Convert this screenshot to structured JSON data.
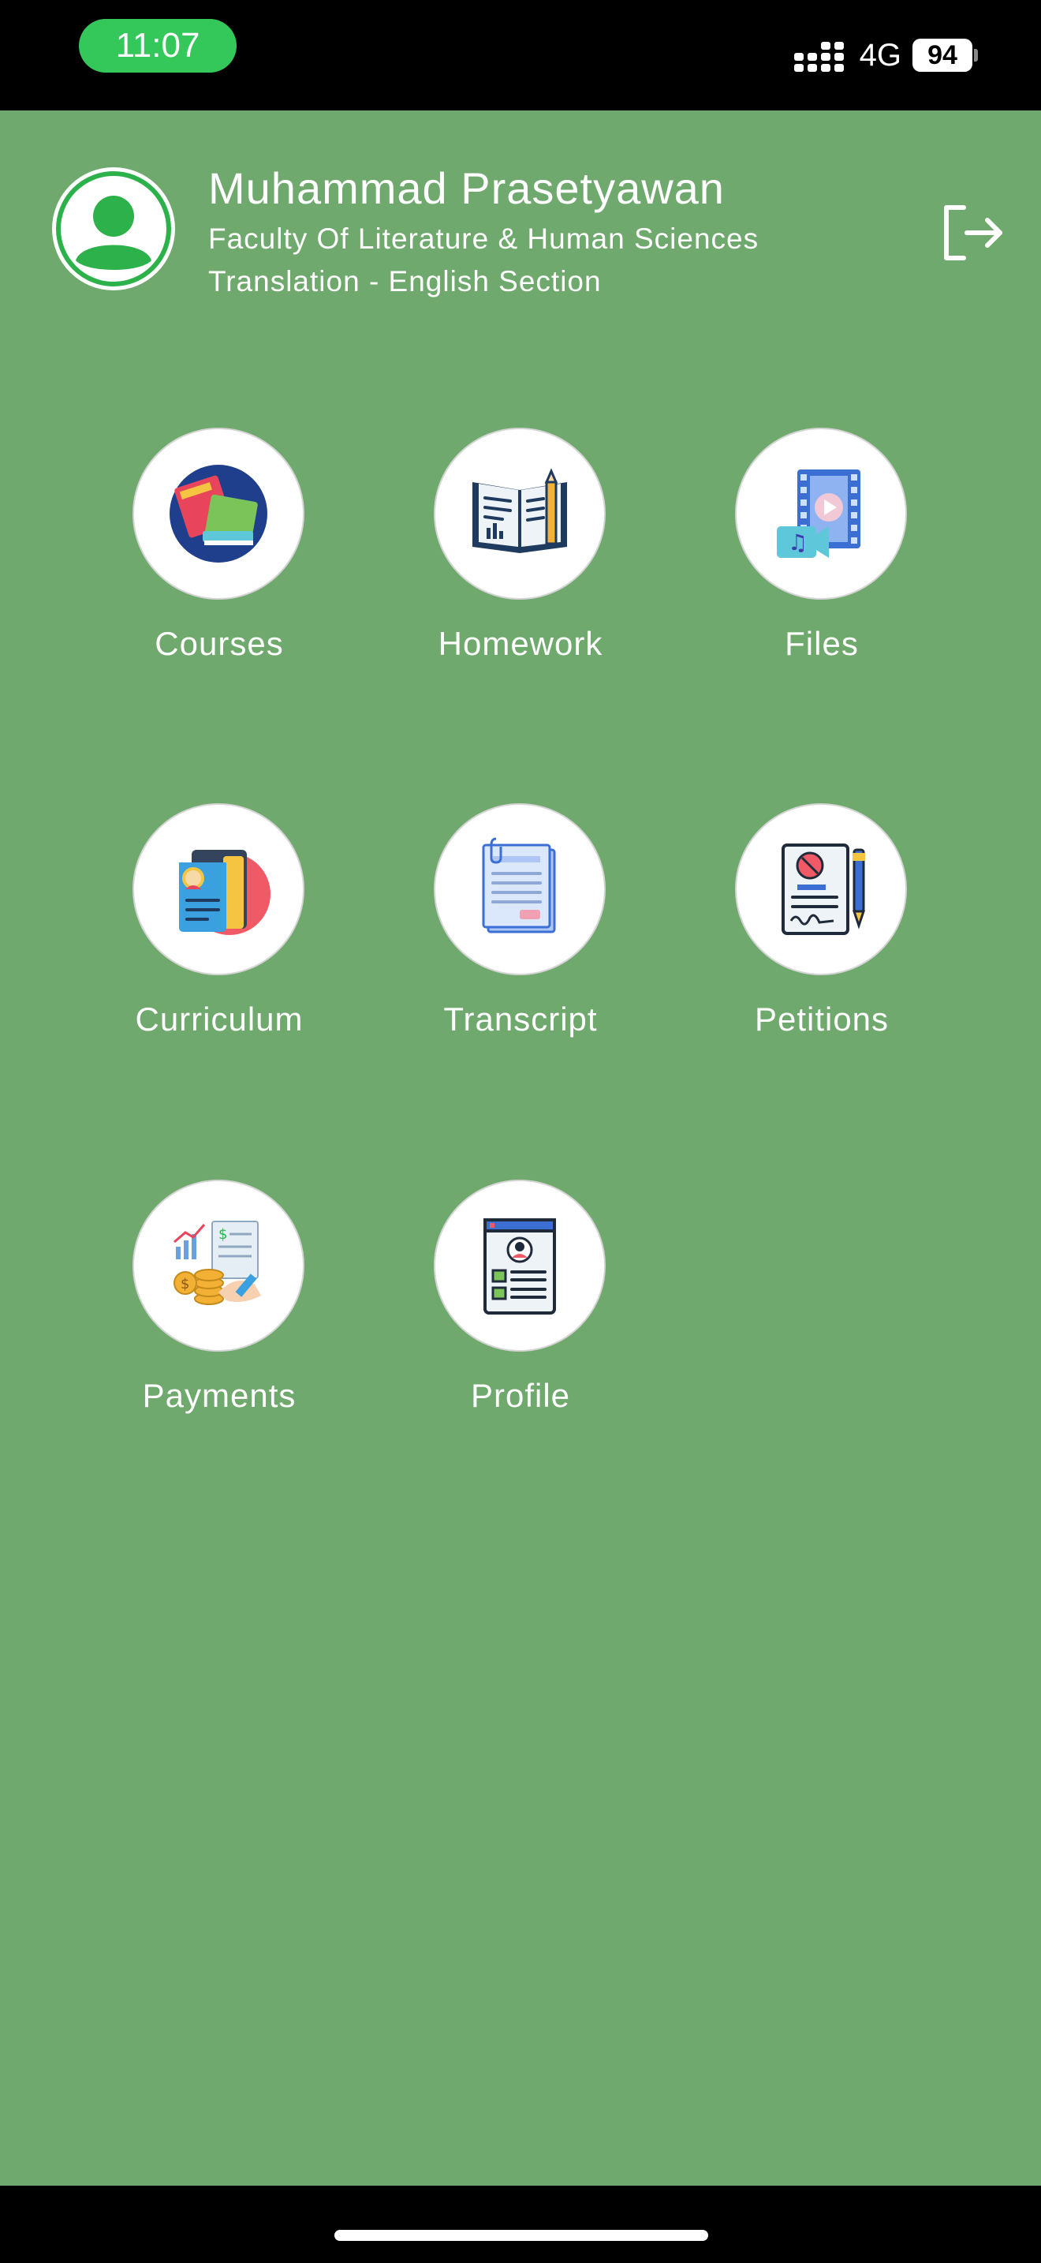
{
  "status_bar": {
    "time": "11:07",
    "network": "4G",
    "battery": "94"
  },
  "user": {
    "name": "Muhammad  Prasetyawan",
    "faculty": "Faculty Of Literature & Human Sciences",
    "section": "Translation - English Section"
  },
  "menu": [
    {
      "label": "Courses",
      "icon": "courses-icon"
    },
    {
      "label": "Homework",
      "icon": "homework-icon"
    },
    {
      "label": "Files",
      "icon": "files-icon"
    },
    {
      "label": "Curriculum",
      "icon": "curriculum-icon"
    },
    {
      "label": "Transcript",
      "icon": "transcript-icon"
    },
    {
      "label": "Petitions",
      "icon": "petitions-icon"
    },
    {
      "label": "Payments",
      "icon": "payments-icon"
    },
    {
      "label": "Profile",
      "icon": "profile-icon"
    }
  ],
  "colors": {
    "background": "#70a96d",
    "status_pill": "#34c759",
    "avatar_green": "#2db14b"
  }
}
